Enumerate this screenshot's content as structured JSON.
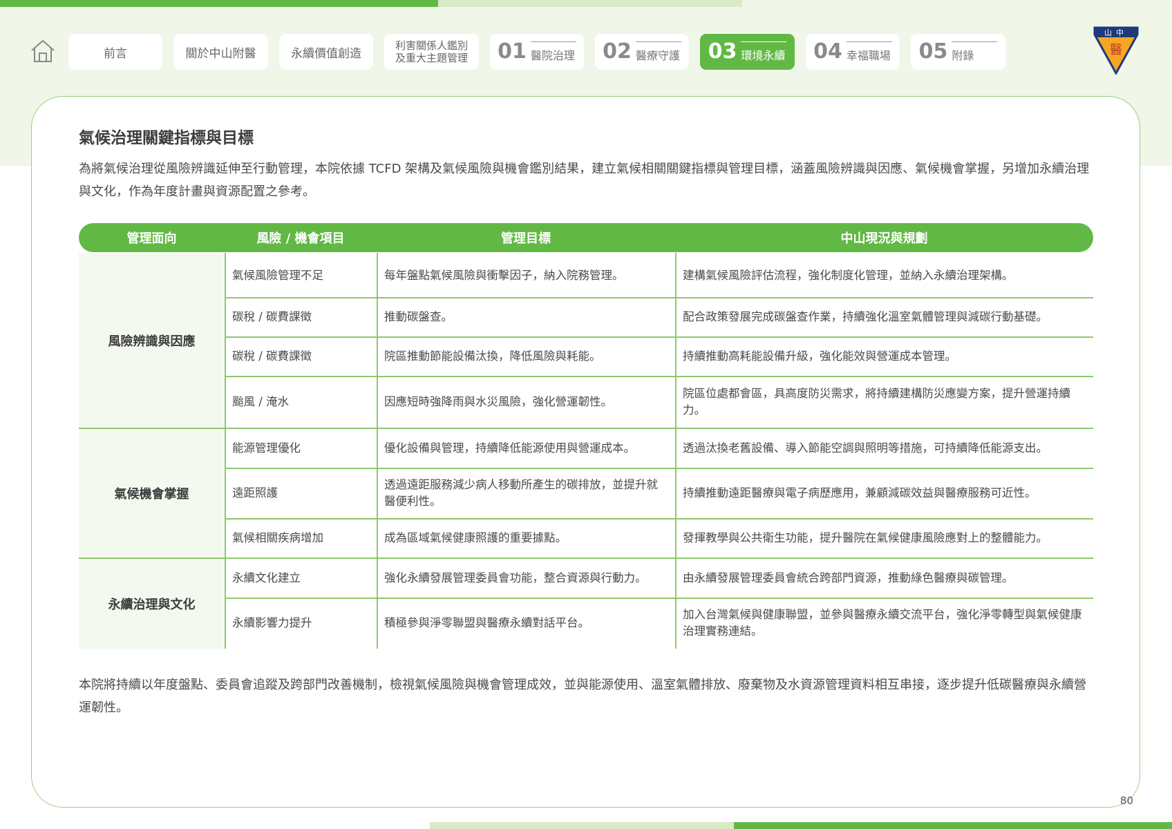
{
  "nav": {
    "home_icon": "home-icon",
    "tabs": [
      {
        "label": "前言"
      },
      {
        "label": "關於中山附醫"
      },
      {
        "label": "永續價值創造"
      },
      {
        "line1": "利害關係人鑑別",
        "line2": "及重大主題管理"
      },
      {
        "number": "01",
        "label": "醫院治理"
      },
      {
        "number": "02",
        "label": "醫療守護"
      },
      {
        "number": "03",
        "label": "環境永續",
        "active": true
      },
      {
        "number": "04",
        "label": "幸福職場"
      },
      {
        "number": "05",
        "label": "附錄"
      }
    ]
  },
  "logo": {
    "text": "山中",
    "badge": "醫"
  },
  "heading": "氣候治理關鍵指標與目標",
  "intro": "為將氣候治理從風險辨識延伸至行動管理，本院依據 TCFD 架構及氣候風險與機會鑑別結果，建立氣候相關關鍵指標與管理目標，涵蓋風險辨識與因應、氣候機會掌握，另增加永續治理與文化，作為年度計畫與資源配置之參考。",
  "table": {
    "headers": [
      "管理面向",
      "風險 / 機會項目",
      "管理目標",
      "中山現況與規劃"
    ],
    "groups": [
      {
        "name": "風險辨識與因應",
        "rows": [
          {
            "item": "氣候風險管理不足",
            "target": "每年盤點氣候風險與衝擊因子，納入院務管理。",
            "status": "建構氣候風險評估流程，強化制度化管理，並納入永續治理架構。"
          },
          {
            "item": "碳稅 / 碳費課徵",
            "target": "推動碳盤查。",
            "status": "配合政策發展完成碳盤查作業，持續強化溫室氣體管理與減碳行動基礎。"
          },
          {
            "item": "碳稅 / 碳費課徵",
            "target": "院區推動節能設備汰換，降低風險與耗能。",
            "status": "持續推動高耗能設備升級，強化能效與營運成本管理。"
          },
          {
            "item": "颱風 / 淹水",
            "target": "因應短時強降雨與水災風險，強化營運韌性。",
            "status": "院區位處都會區，具高度防災需求，將持續建構防災應變方案，提升營運持續力。"
          }
        ]
      },
      {
        "name": "氣候機會掌握",
        "rows": [
          {
            "item": "能源管理優化",
            "target": "優化設備與管理，持續降低能源使用與營運成本。",
            "status": "透過汰換老舊設備、導入節能空調與照明等措施，可持續降低能源支出。"
          },
          {
            "item": "遠距照護",
            "target": "透過遠距服務減少病人移動所產生的碳排放，並提升就醫便利性。",
            "status": "持續推動遠距醫療與電子病歷應用，兼顧減碳效益與醫療服務可近性。"
          },
          {
            "item": "氣候相關疾病增加",
            "target": "成為區域氣候健康照護的重要據點。",
            "status": "發揮教學與公共衛生功能，提升醫院在氣候健康風險應對上的整體能力。"
          }
        ]
      },
      {
        "name": "永續治理與文化",
        "rows": [
          {
            "item": "永續文化建立",
            "target": "強化永續發展管理委員會功能，整合資源與行動力。",
            "status": "由永續發展管理委員會統合跨部門資源，推動綠色醫療與碳管理。"
          },
          {
            "item": "永續影響力提升",
            "target": "積極參與淨零聯盟與醫療永續對話平台。",
            "status": "加入台灣氣候與健康聯盟，並參與醫療永續交流平台，強化淨零轉型與氣候健康治理實務連結。"
          }
        ]
      }
    ]
  },
  "outro": "本院將持續以年度盤點、委員會追蹤及跨部門改善機制，檢視氣候風險與機會管理成效，並與能源使用、溫室氣體排放、廢棄物及水資源管理資料相互串接，逐步提升低碳醫療與永續營運韌性。",
  "page_number": "80",
  "colors": {
    "accent": "#62b845",
    "accent_light": "#d8eac6",
    "band": "#f0f6e8",
    "line": "#8dc86d"
  }
}
